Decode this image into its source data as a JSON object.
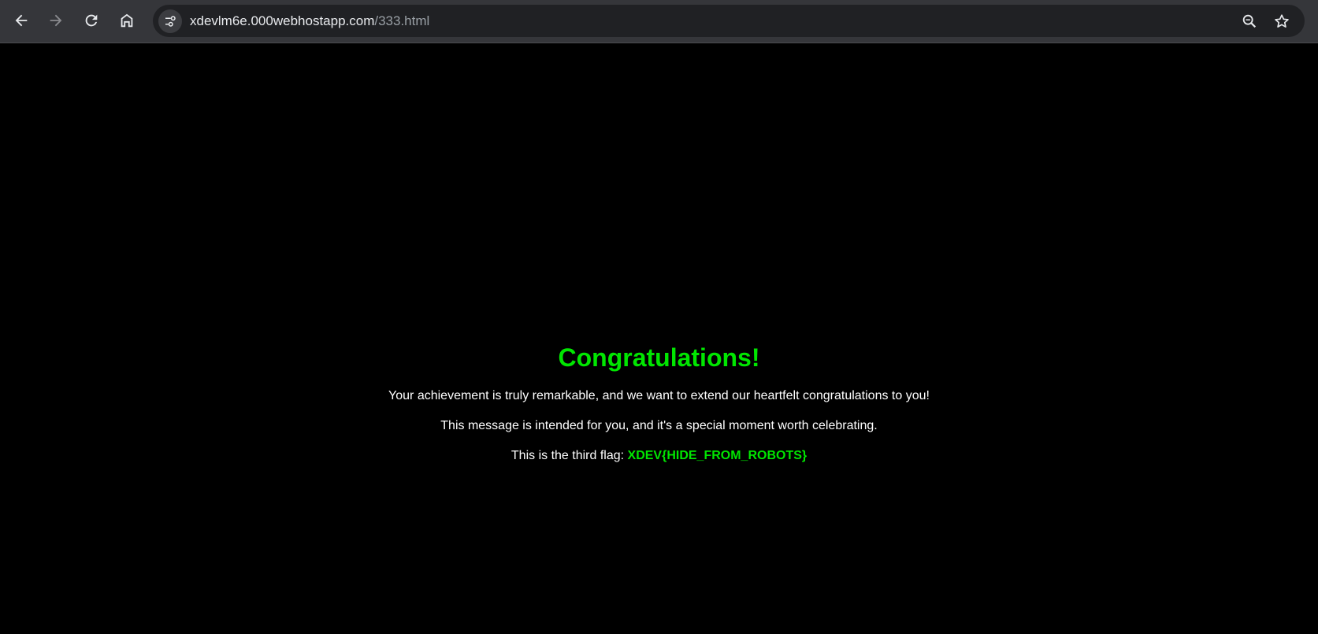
{
  "browser": {
    "url_host": "xdevlm6e.000webhostapp.com",
    "url_path": "/333.html",
    "icons": {
      "back": "arrow-left-icon",
      "forward": "arrow-right-icon",
      "reload": "reload-icon",
      "home": "home-icon",
      "site_info": "tune-icon",
      "zoom": "magnifier-icon",
      "bookmark": "star-icon"
    }
  },
  "page": {
    "heading": "Congratulations!",
    "line1": "Your achievement is truly remarkable, and we want to extend our heartfelt congratulations to you!",
    "line2": "This message is intended for you, and it's a special moment worth celebrating.",
    "line3_prefix": "This is the third flag: ",
    "flag": "XDEV{HIDE_FROM_ROBOTS}"
  },
  "colors": {
    "background": "#000000",
    "accent_green": "#00e600",
    "text": "#ffffff"
  }
}
